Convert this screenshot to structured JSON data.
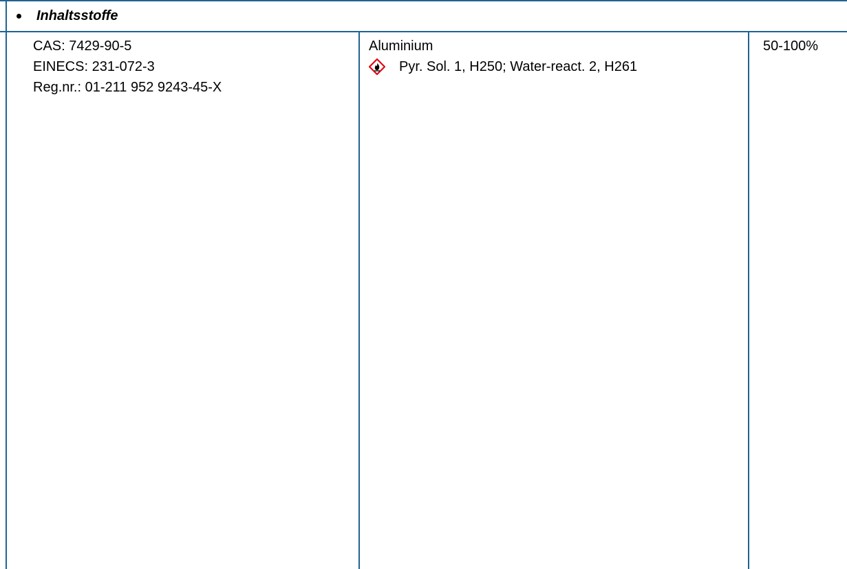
{
  "section": {
    "heading": "Inhaltsstoffe"
  },
  "ingredient": {
    "identifiers": [
      "CAS: 7429-90-5",
      "EINECS: 231-072-3",
      "Reg.nr.: 01-211 952 9243-45-X"
    ],
    "name": "Aluminium",
    "pictogram": "ghs-flame-icon",
    "classification": "Pyr. Sol. 1, H250; Water-react. 2, H261",
    "concentration": "50-100%"
  },
  "colors": {
    "border": "#1f6391",
    "pictogram_red": "#e30613"
  }
}
